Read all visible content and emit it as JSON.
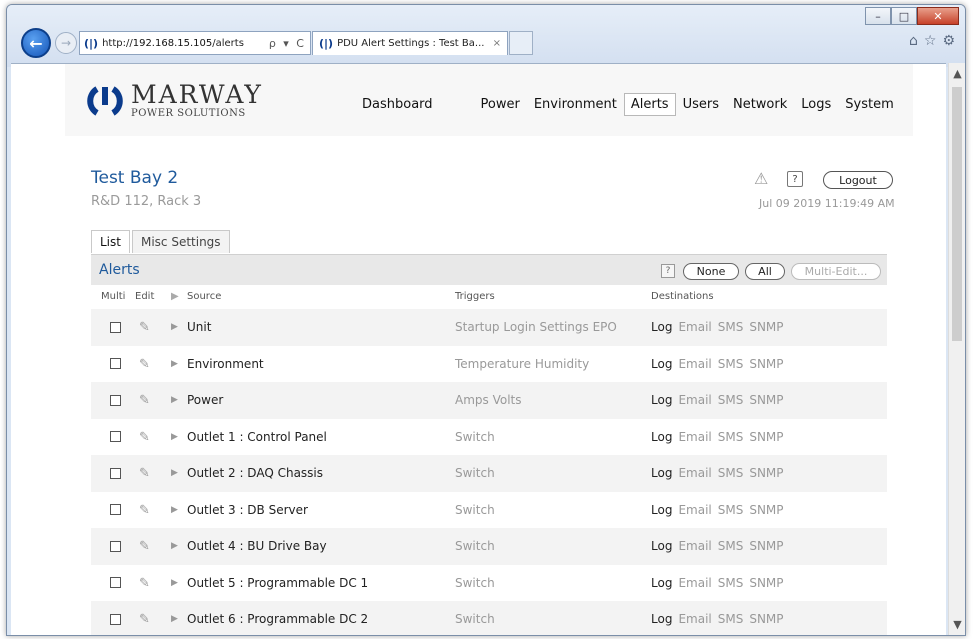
{
  "browser": {
    "url_prefix": "http://",
    "url_host": "192.168.15.105",
    "url_path": "/alerts",
    "address_tools": "ρ ▾ C",
    "tab_title": "PDU Alert Settings : Test Ba...",
    "tab_close": "×"
  },
  "header": {
    "logo_name": "MARWAY",
    "logo_sub": "POWER SOLUTIONS",
    "nav": [
      "Dashboard",
      "Power",
      "Environment",
      "Alerts",
      "Users",
      "Network",
      "Logs",
      "System"
    ],
    "active_nav": "Alerts"
  },
  "device": {
    "name": "Test Bay 2",
    "location": "R&D 112, Rack 3",
    "help": "?",
    "logout": "Logout",
    "datetime": "Jul 09 2019 11:19:49 AM"
  },
  "tabs": [
    "List",
    "Misc Settings"
  ],
  "panel": {
    "title": "Alerts",
    "help": "?",
    "none_btn": "None",
    "all_btn": "All",
    "multi_edit_btn": "Multi-Edit..."
  },
  "columns": {
    "multi": "Multi",
    "edit": "Edit",
    "source": "Source",
    "triggers": "Triggers",
    "destinations": "Destinations"
  },
  "rows": [
    {
      "source": "Unit",
      "triggers": "Startup  Login  Settings  EPO"
    },
    {
      "source": "Environment",
      "triggers": "Temperature  Humidity"
    },
    {
      "source": "Power",
      "triggers": "Amps  Volts"
    },
    {
      "source": "Outlet 1 : Control Panel",
      "triggers": "Switch"
    },
    {
      "source": "Outlet 2 : DAQ Chassis",
      "triggers": "Switch"
    },
    {
      "source": "Outlet 3 : DB Server",
      "triggers": "Switch"
    },
    {
      "source": "Outlet 4 : BU Drive Bay",
      "triggers": "Switch"
    },
    {
      "source": "Outlet 5 : Programmable DC 1",
      "triggers": "Switch"
    },
    {
      "source": "Outlet 6 : Programmable DC 2",
      "triggers": "Switch"
    }
  ],
  "destinations": [
    "Log",
    "Email",
    "SMS",
    "SNMP"
  ],
  "colors": {
    "accent_blue": "#1f5a9c",
    "muted_gray": "#999999"
  }
}
